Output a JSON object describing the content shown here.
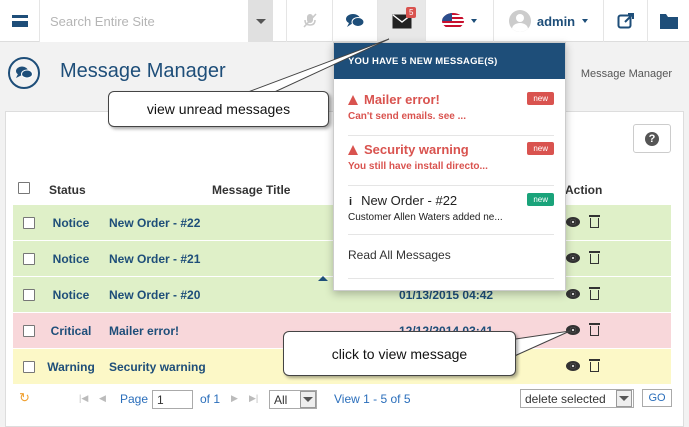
{
  "topbar": {
    "search_placeholder": "Search Entire Site",
    "messages_count": "5",
    "user_name": "admin"
  },
  "page": {
    "title": "Message Manager",
    "breadcrumb": "Message Manager"
  },
  "table": {
    "headers": {
      "status": "Status",
      "title": "Message Title",
      "action": "Action"
    },
    "rows": [
      {
        "status": "Notice",
        "title": "New Order - #22",
        "date": ""
      },
      {
        "status": "Notice",
        "title": "New Order - #21",
        "date": ""
      },
      {
        "status": "Notice",
        "title": "New Order - #20",
        "date": "01/13/2015 04:42"
      },
      {
        "status": "Critical",
        "title": "Mailer error!",
        "date": "12/12/2014 03:41"
      },
      {
        "status": "Warning",
        "title": "Security warning",
        "date": ""
      }
    ]
  },
  "pager": {
    "page_label": "Page",
    "page_value": "1",
    "of_label": "of 1",
    "rows_value": "All",
    "view_text": "View 1 - 5 of 5",
    "bulk_action": "delete selected",
    "go_label": "GO"
  },
  "dropdown": {
    "header": "YOU HAVE 5 NEW MESSAGE(S)",
    "items": [
      {
        "title": "Mailer error!",
        "subtitle": "Can't send emails. see ...",
        "badge": "new"
      },
      {
        "title": "Security warning",
        "subtitle": "You still have install directo...",
        "badge": "new"
      },
      {
        "title": "New Order - #22",
        "subtitle": "Customer Allen Waters added ne...",
        "badge": "new"
      }
    ],
    "read_all": "Read All Messages"
  },
  "callouts": {
    "unread": "view unread messages",
    "view": "click to view message"
  },
  "colors": {
    "brand": "#1e4e79",
    "danger": "#d9534f",
    "success": "#1aa37a",
    "row_notice": "#dff0c8",
    "row_critical": "#f8d7da",
    "row_warning": "#fcf8c7"
  }
}
